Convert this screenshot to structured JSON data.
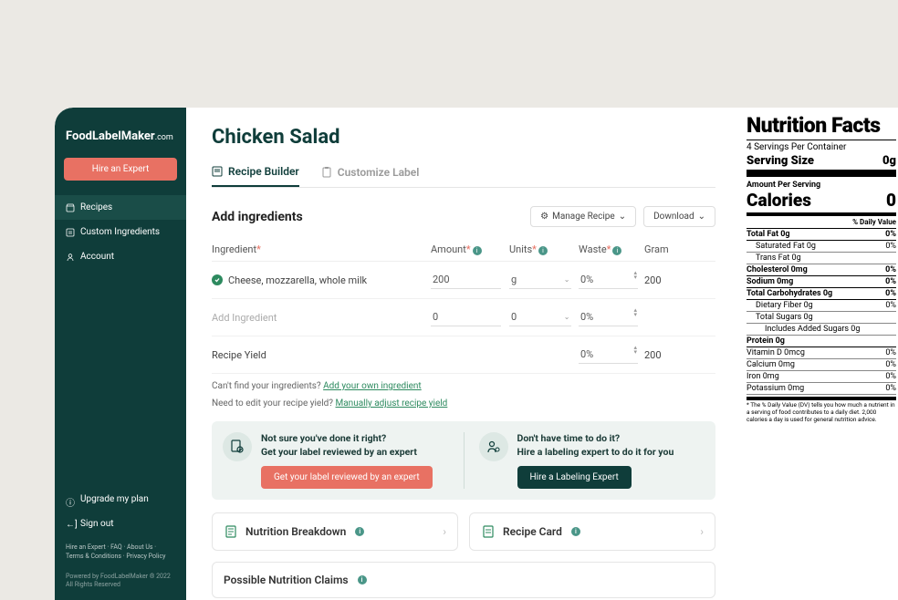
{
  "brand": {
    "name": "FoodLabelMaker",
    "suffix": ".com"
  },
  "sidebar": {
    "hire_btn": "Hire an Expert",
    "items": [
      {
        "label": "Recipes",
        "active": true
      },
      {
        "label": "Custom Ingredients",
        "active": false
      },
      {
        "label": "Account",
        "active": false
      }
    ],
    "upgrade": "Upgrade my plan",
    "signout": "Sign out",
    "footer_links": "Hire an Expert · FAQ · About Us · Terms & Conditions · Privacy Policy",
    "copyright": "Powered by FoodLabelMaker ® 2022 All Rights Reserved"
  },
  "page": {
    "title": "Chicken Salad",
    "tabs": [
      {
        "label": "Recipe Builder",
        "active": true
      },
      {
        "label": "Customize Label",
        "active": false
      }
    ]
  },
  "ingredients": {
    "section_title": "Add ingredients",
    "manage_btn": "Manage Recipe",
    "download_btn": "Download",
    "headers": {
      "ingredient": "Ingredient",
      "amount": "Amount",
      "units": "Units",
      "waste": "Waste",
      "gram": "Gram"
    },
    "rows": [
      {
        "name": "Cheese, mozzarella, whole milk",
        "amount": "200",
        "unit": "g",
        "waste": "0%",
        "gram": "200",
        "verified": true
      },
      {
        "name": "",
        "placeholder": "Add Ingredient",
        "amount": "0",
        "unit": "0",
        "waste": "0%",
        "gram": "",
        "verified": false
      }
    ],
    "yield_label": "Recipe Yield",
    "yield_waste": "0%",
    "yield_gram": "200",
    "helper1_text": "Can't find your ingredients?",
    "helper1_link": "Add your own ingredient",
    "helper2_text": "Need to edit your recipe yield?",
    "helper2_link": "Manually adjust recipe yield"
  },
  "promos": [
    {
      "q": "Not sure you've done it right?",
      "line": "Get your label reviewed by an expert",
      "btn": "Get your label reviewed by an expert",
      "btn_class": "btn-orange"
    },
    {
      "q": "Don't have time to do it?",
      "line": "Hire a labeling expert to do it for you",
      "btn": "Hire a Labeling Expert",
      "btn_class": "btn-green"
    }
  ],
  "cards": [
    {
      "label": "Nutrition Breakdown"
    },
    {
      "label": "Recipe Card"
    }
  ],
  "claims_label": "Possible Nutrition Claims",
  "nutrition": {
    "title": "Nutrition Facts",
    "servings": "4 Servings Per Container",
    "serving_size_label": "Serving Size",
    "serving_size_value": "0g",
    "aps": "Amount Per Serving",
    "calories_label": "Calories",
    "calories_value": "0",
    "dv_header": "% Daily Value",
    "rows": [
      {
        "label": "Total Fat 0g",
        "dv": "0%",
        "bold": true
      },
      {
        "label": "Saturated Fat 0g",
        "dv": "0%",
        "indent": 1
      },
      {
        "label": "Trans Fat 0g",
        "dv": "",
        "indent": 1
      },
      {
        "label": "Cholesterol 0mg",
        "dv": "0%",
        "bold": true
      },
      {
        "label": "Sodium 0mg",
        "dv": "0%",
        "bold": true
      },
      {
        "label": "Total Carbohydrates 0g",
        "dv": "0%",
        "bold": true
      },
      {
        "label": "Dietary Fiber 0g",
        "dv": "0%",
        "indent": 1
      },
      {
        "label": "Total Sugars 0g",
        "dv": "",
        "indent": 1
      },
      {
        "label": "Includes Added Sugars 0g",
        "dv": "",
        "indent": 2
      },
      {
        "label": "Protein 0g",
        "dv": "",
        "bold": true,
        "thick": true
      }
    ],
    "vitamins": [
      {
        "label": "Vitamin D 0mcg",
        "dv": "0%"
      },
      {
        "label": "Calcium 0mg",
        "dv": "0%"
      },
      {
        "label": "Iron 0mg",
        "dv": "0%"
      },
      {
        "label": "Potassium 0mg",
        "dv": "0%"
      }
    ],
    "note": "* The % Daily Value (DV) tells you how much a nutrient in a serving of food contributes to a daily diet. 2,000 calories a day is used for general nutrition advice."
  }
}
